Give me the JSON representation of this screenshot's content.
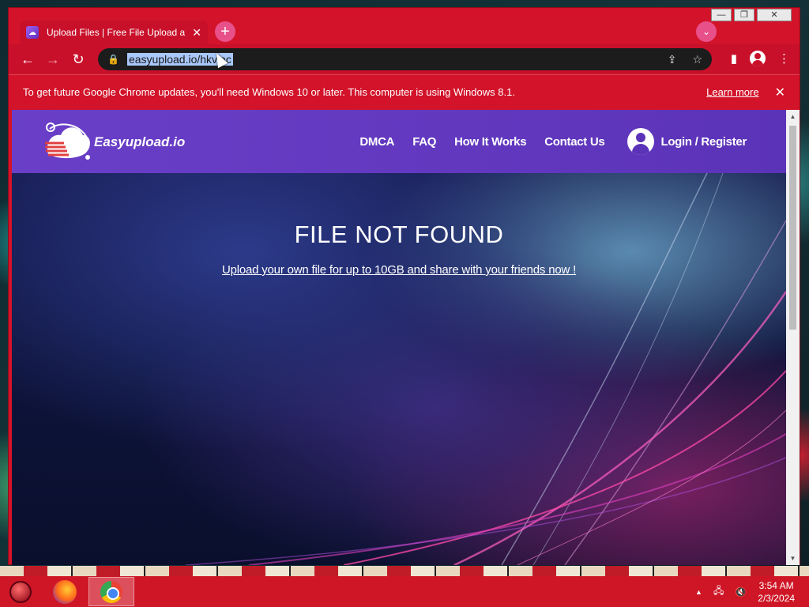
{
  "browser": {
    "tab_title": "Upload Files | Free File Upload and Sharing",
    "tab_close": "✕",
    "new_tab": "+",
    "tab_search": "⌄",
    "back": "←",
    "forward": "→",
    "reload": "↻",
    "url": "easyupload.io/hkvlac",
    "caption": {
      "minimize": "—",
      "maximize": "❐",
      "close": "✕"
    },
    "accent_color": "#c8102a"
  },
  "infobar": {
    "message": "To get future Google Chrome updates, you'll need Windows 10 or later. This computer is using Windows 8.1.",
    "learn_more": "Learn more",
    "close": "✕"
  },
  "site": {
    "logo_text": "Easyupload.io",
    "nav": [
      "DMCA",
      "FAQ",
      "How It Works",
      "Contact Us"
    ],
    "login": "Login / Register",
    "header_color": "#5b33b8"
  },
  "hero": {
    "title": "FILE NOT FOUND",
    "link": "Upload your own file for up to 10GB and share with your friends now !"
  },
  "taskbar": {
    "apps": [
      "start-orb",
      "firefox",
      "chrome"
    ],
    "time": "3:54 AM",
    "date": "2/3/2024",
    "tray": {
      "arrow": "▲",
      "network": "🖧",
      "volume": "🔇"
    }
  }
}
